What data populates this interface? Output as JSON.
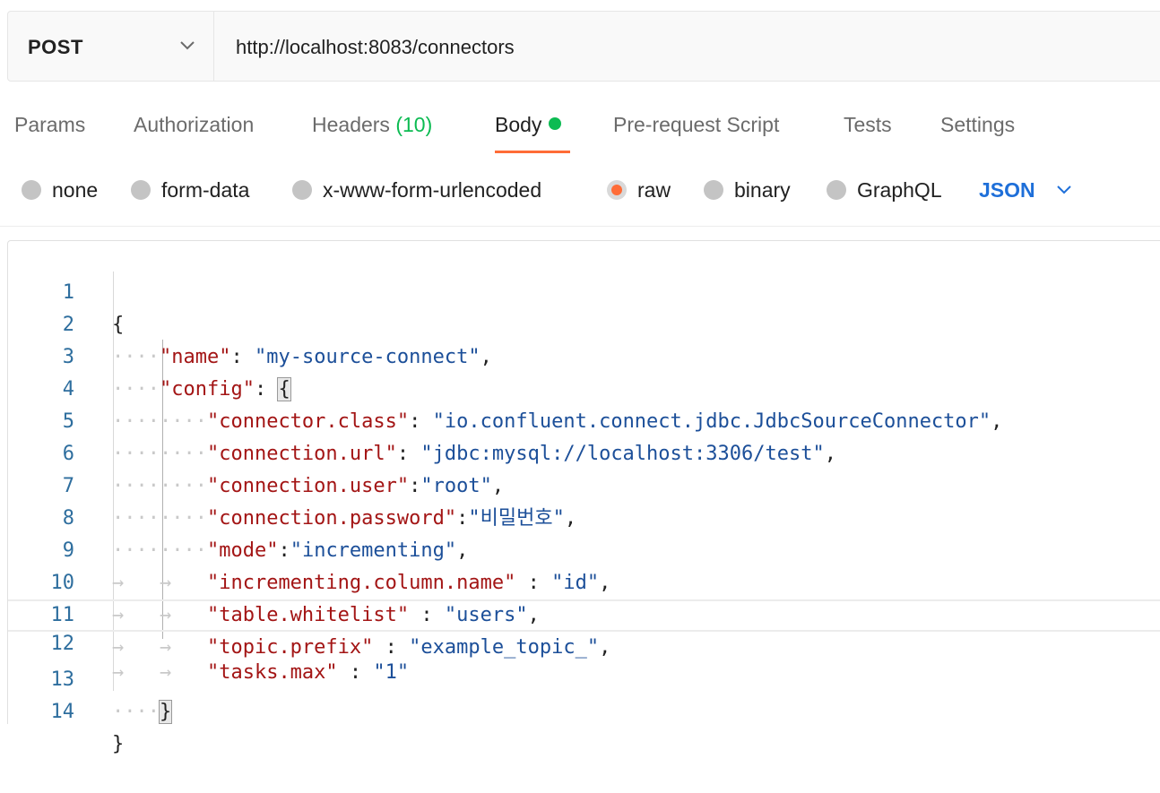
{
  "request": {
    "method": "POST",
    "url": "http://localhost:8083/connectors"
  },
  "tabs": [
    {
      "label": "Params"
    },
    {
      "label": "Authorization"
    },
    {
      "label": "Headers",
      "count": "(10)"
    },
    {
      "label": "Body",
      "active": true,
      "indicator": "green-dot"
    },
    {
      "label": "Pre-request Script"
    },
    {
      "label": "Tests"
    },
    {
      "label": "Settings"
    }
  ],
  "body_types": {
    "options": [
      "none",
      "form-data",
      "x-www-form-urlencoded",
      "raw",
      "binary",
      "GraphQL"
    ],
    "selected": "raw",
    "language": "JSON"
  },
  "colors": {
    "accent": "#ff6c37",
    "active_green": "#0cbb52",
    "link_blue": "#1e6fd9",
    "json_key": "#a31515",
    "json_string": "#1c4f99",
    "line_number": "#2e6e9e"
  },
  "editor": {
    "current_line": 12,
    "lines": [
      {
        "num": "1",
        "text": "{"
      },
      {
        "num": "2",
        "ws": "····",
        "key": "\"name\"",
        "sep": ": ",
        "value": "\"my-source-connect\"",
        "end": ","
      },
      {
        "num": "3",
        "ws": "····",
        "key": "\"config\"",
        "sep": ": ",
        "brace": "{"
      },
      {
        "num": "4",
        "ws": "········",
        "key": "\"connector.class\"",
        "sep": ": ",
        "value": "\"io.confluent.connect.jdbc.JdbcSourceConnector\"",
        "end": ","
      },
      {
        "num": "5",
        "ws": "········",
        "key": "\"connection.url\"",
        "sep": ": ",
        "value": "\"jdbc:mysql://localhost:3306/test\"",
        "end": ","
      },
      {
        "num": "6",
        "ws": "········",
        "key": "\"connection.user\"",
        "sep": ":",
        "value": "\"root\"",
        "end": ","
      },
      {
        "num": "7",
        "ws": "········",
        "key": "\"connection.password\"",
        "sep": ":",
        "value": "\"비밀번호\"",
        "end": ","
      },
      {
        "num": "8",
        "ws": "········",
        "key": "\"mode\"",
        "sep": ":",
        "value": "\"incrementing\"",
        "end": ","
      },
      {
        "num": "9",
        "ws": "→   →   ",
        "key": "\"incrementing.column.name\"",
        "sep": " : ",
        "value": "\"id\"",
        "end": ","
      },
      {
        "num": "10",
        "ws": "→   →   ",
        "key": "\"table.whitelist\"",
        "sep": " : ",
        "value": "\"users\"",
        "end": ","
      },
      {
        "num": "11",
        "ws": "→   →   ",
        "key": "\"topic.prefix\"",
        "sep": " : ",
        "value": "\"example_topic_\"",
        "end": ","
      },
      {
        "num": "12",
        "ws": "→   →   ",
        "key": "\"tasks.max\"",
        "sep": " : ",
        "value": "\"1\"",
        "end": ""
      },
      {
        "num": "13",
        "ws": "····",
        "brace": "}"
      },
      {
        "num": "14",
        "text": "}"
      }
    ]
  }
}
